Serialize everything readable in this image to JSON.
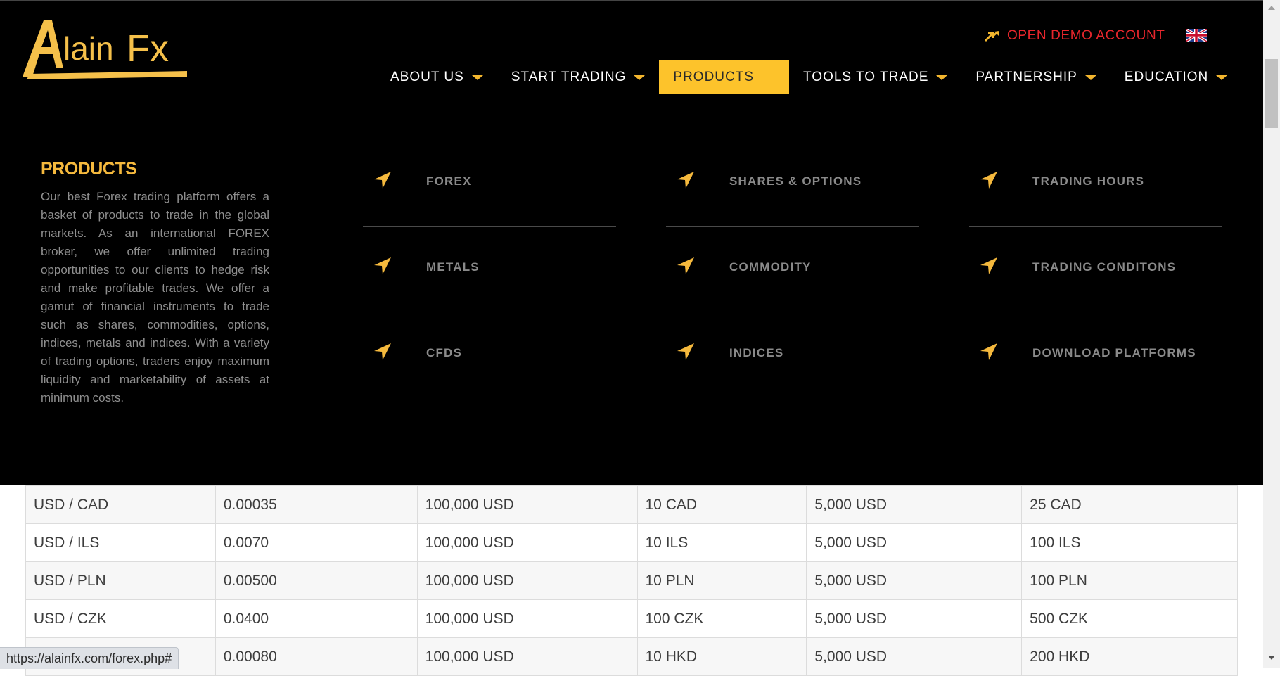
{
  "header": {
    "logo_text": "AlainFx",
    "demo_link": "OPEN DEMO ACCOUNT",
    "demo_color": "#e8262c",
    "accent_color": "#fdc32b"
  },
  "nav": {
    "items": [
      {
        "label": "ABOUT US"
      },
      {
        "label": "START TRADING"
      },
      {
        "label": "PRODUCTS"
      },
      {
        "label": "TOOLS TO TRADE"
      },
      {
        "label": "PARTNERSHIP"
      },
      {
        "label": "EDUCATION"
      }
    ]
  },
  "mega": {
    "title": "PRODUCTS",
    "description": "Our best Forex trading platform offers a basket of products to trade in the global markets. As an international FOREX broker, we offer unlimited trading opportunities to our clients to hedge risk and make profitable trades. We offer a gamut of financial instruments to trade such as shares, commodities, options, indices, metals and indices. With a variety of trading options, traders enjoy maximum liquidity and marketability of assets at minimum costs.",
    "links": [
      {
        "label": "FOREX"
      },
      {
        "label": "SHARES & OPTIONS"
      },
      {
        "label": "TRADING HOURS"
      },
      {
        "label": "METALS"
      },
      {
        "label": "COMMODITY"
      },
      {
        "label": "TRADING CONDITONS"
      },
      {
        "label": "CFDS"
      },
      {
        "label": "INDICES"
      },
      {
        "label": "DOWNLOAD PLATFORMS"
      }
    ]
  },
  "table": {
    "rows": [
      [
        "USD / CAD",
        "0.00035",
        "100,000 USD",
        "10 CAD",
        "5,000 USD",
        "25 CAD"
      ],
      [
        "USD / ILS",
        "0.0070",
        "100,000 USD",
        "10 ILS",
        "5,000 USD",
        "100 ILS"
      ],
      [
        "USD / PLN",
        "0.00500",
        "100,000 USD",
        "10 PLN",
        "5,000 USD",
        "100 PLN"
      ],
      [
        "USD / CZK",
        "0.0400",
        "100,000 USD",
        "100 CZK",
        "5,000 USD",
        "500 CZK"
      ],
      [
        "",
        "0.00080",
        "100,000 USD",
        "10 HKD",
        "5,000 USD",
        "200 HKD"
      ]
    ]
  },
  "status": {
    "url": "https://alainfx.com/forex.php#"
  }
}
